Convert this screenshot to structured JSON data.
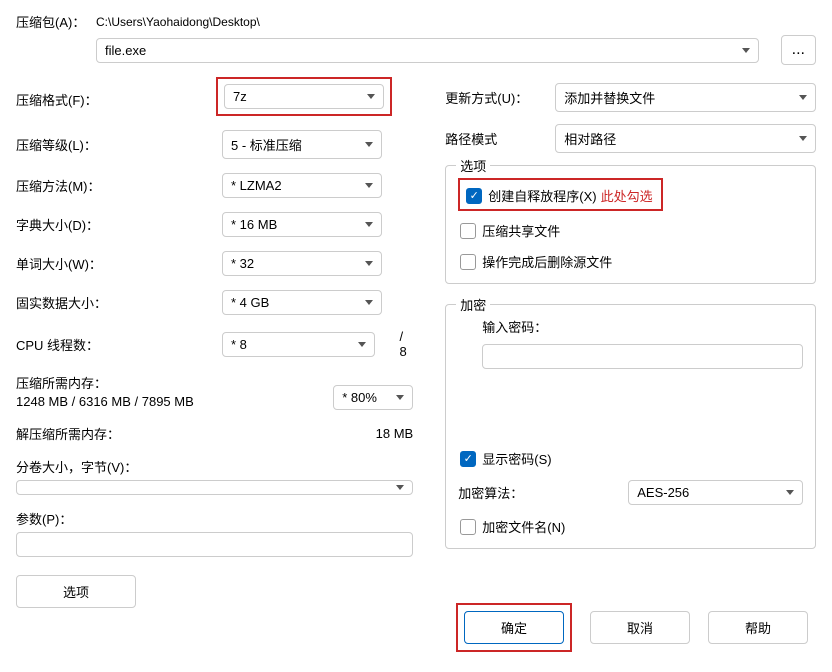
{
  "archive": {
    "label": "压缩包(A)：",
    "path": "C:\\Users\\Yaohaidong\\Desktop\\",
    "file": "file.exe"
  },
  "left": {
    "format_label": "压缩格式(F)：",
    "format_value": "7z",
    "level_label": "压缩等级(L)：",
    "level_value": "5 - 标准压缩",
    "method_label": "压缩方法(M)：",
    "method_value": "* LZMA2",
    "dict_label": "字典大小(D)：",
    "dict_value": "* 16 MB",
    "word_label": "单词大小(W)：",
    "word_value": "* 32",
    "solid_label": "固实数据大小：",
    "solid_value": "* 4 GB",
    "cpu_label": "CPU 线程数：",
    "cpu_value": "* 8",
    "cpu_total": "/ 8",
    "mem_comp_label": "压缩所需内存：",
    "mem_comp_values": "1248 MB / 6316 MB / 7895 MB",
    "mem_percent": "* 80%",
    "mem_decomp_label": "解压缩所需内存：",
    "mem_decomp_value": "18 MB",
    "split_label": "分卷大小，字节(V)：",
    "params_label": "参数(P)：",
    "options_btn": "选项"
  },
  "right": {
    "update_label": "更新方式(U)：",
    "update_value": "添加并替换文件",
    "pathmode_label": "路径模式",
    "pathmode_value": "相对路径",
    "options_legend": "选项",
    "sfx_label": "创建自释放程序(X)",
    "sfx_note": "此处勾选",
    "shared_label": "压缩共享文件",
    "delete_label": "操作完成后删除源文件",
    "enc_legend": "加密",
    "enc_pw_label": "输入密码：",
    "enc_show_label": "显示密码(S)",
    "enc_algo_label": "加密算法：",
    "enc_algo_value": "AES-256",
    "enc_names_label": "加密文件名(N)"
  },
  "buttons": {
    "ok": "确定",
    "cancel": "取消",
    "help": "帮助",
    "more": "..."
  }
}
